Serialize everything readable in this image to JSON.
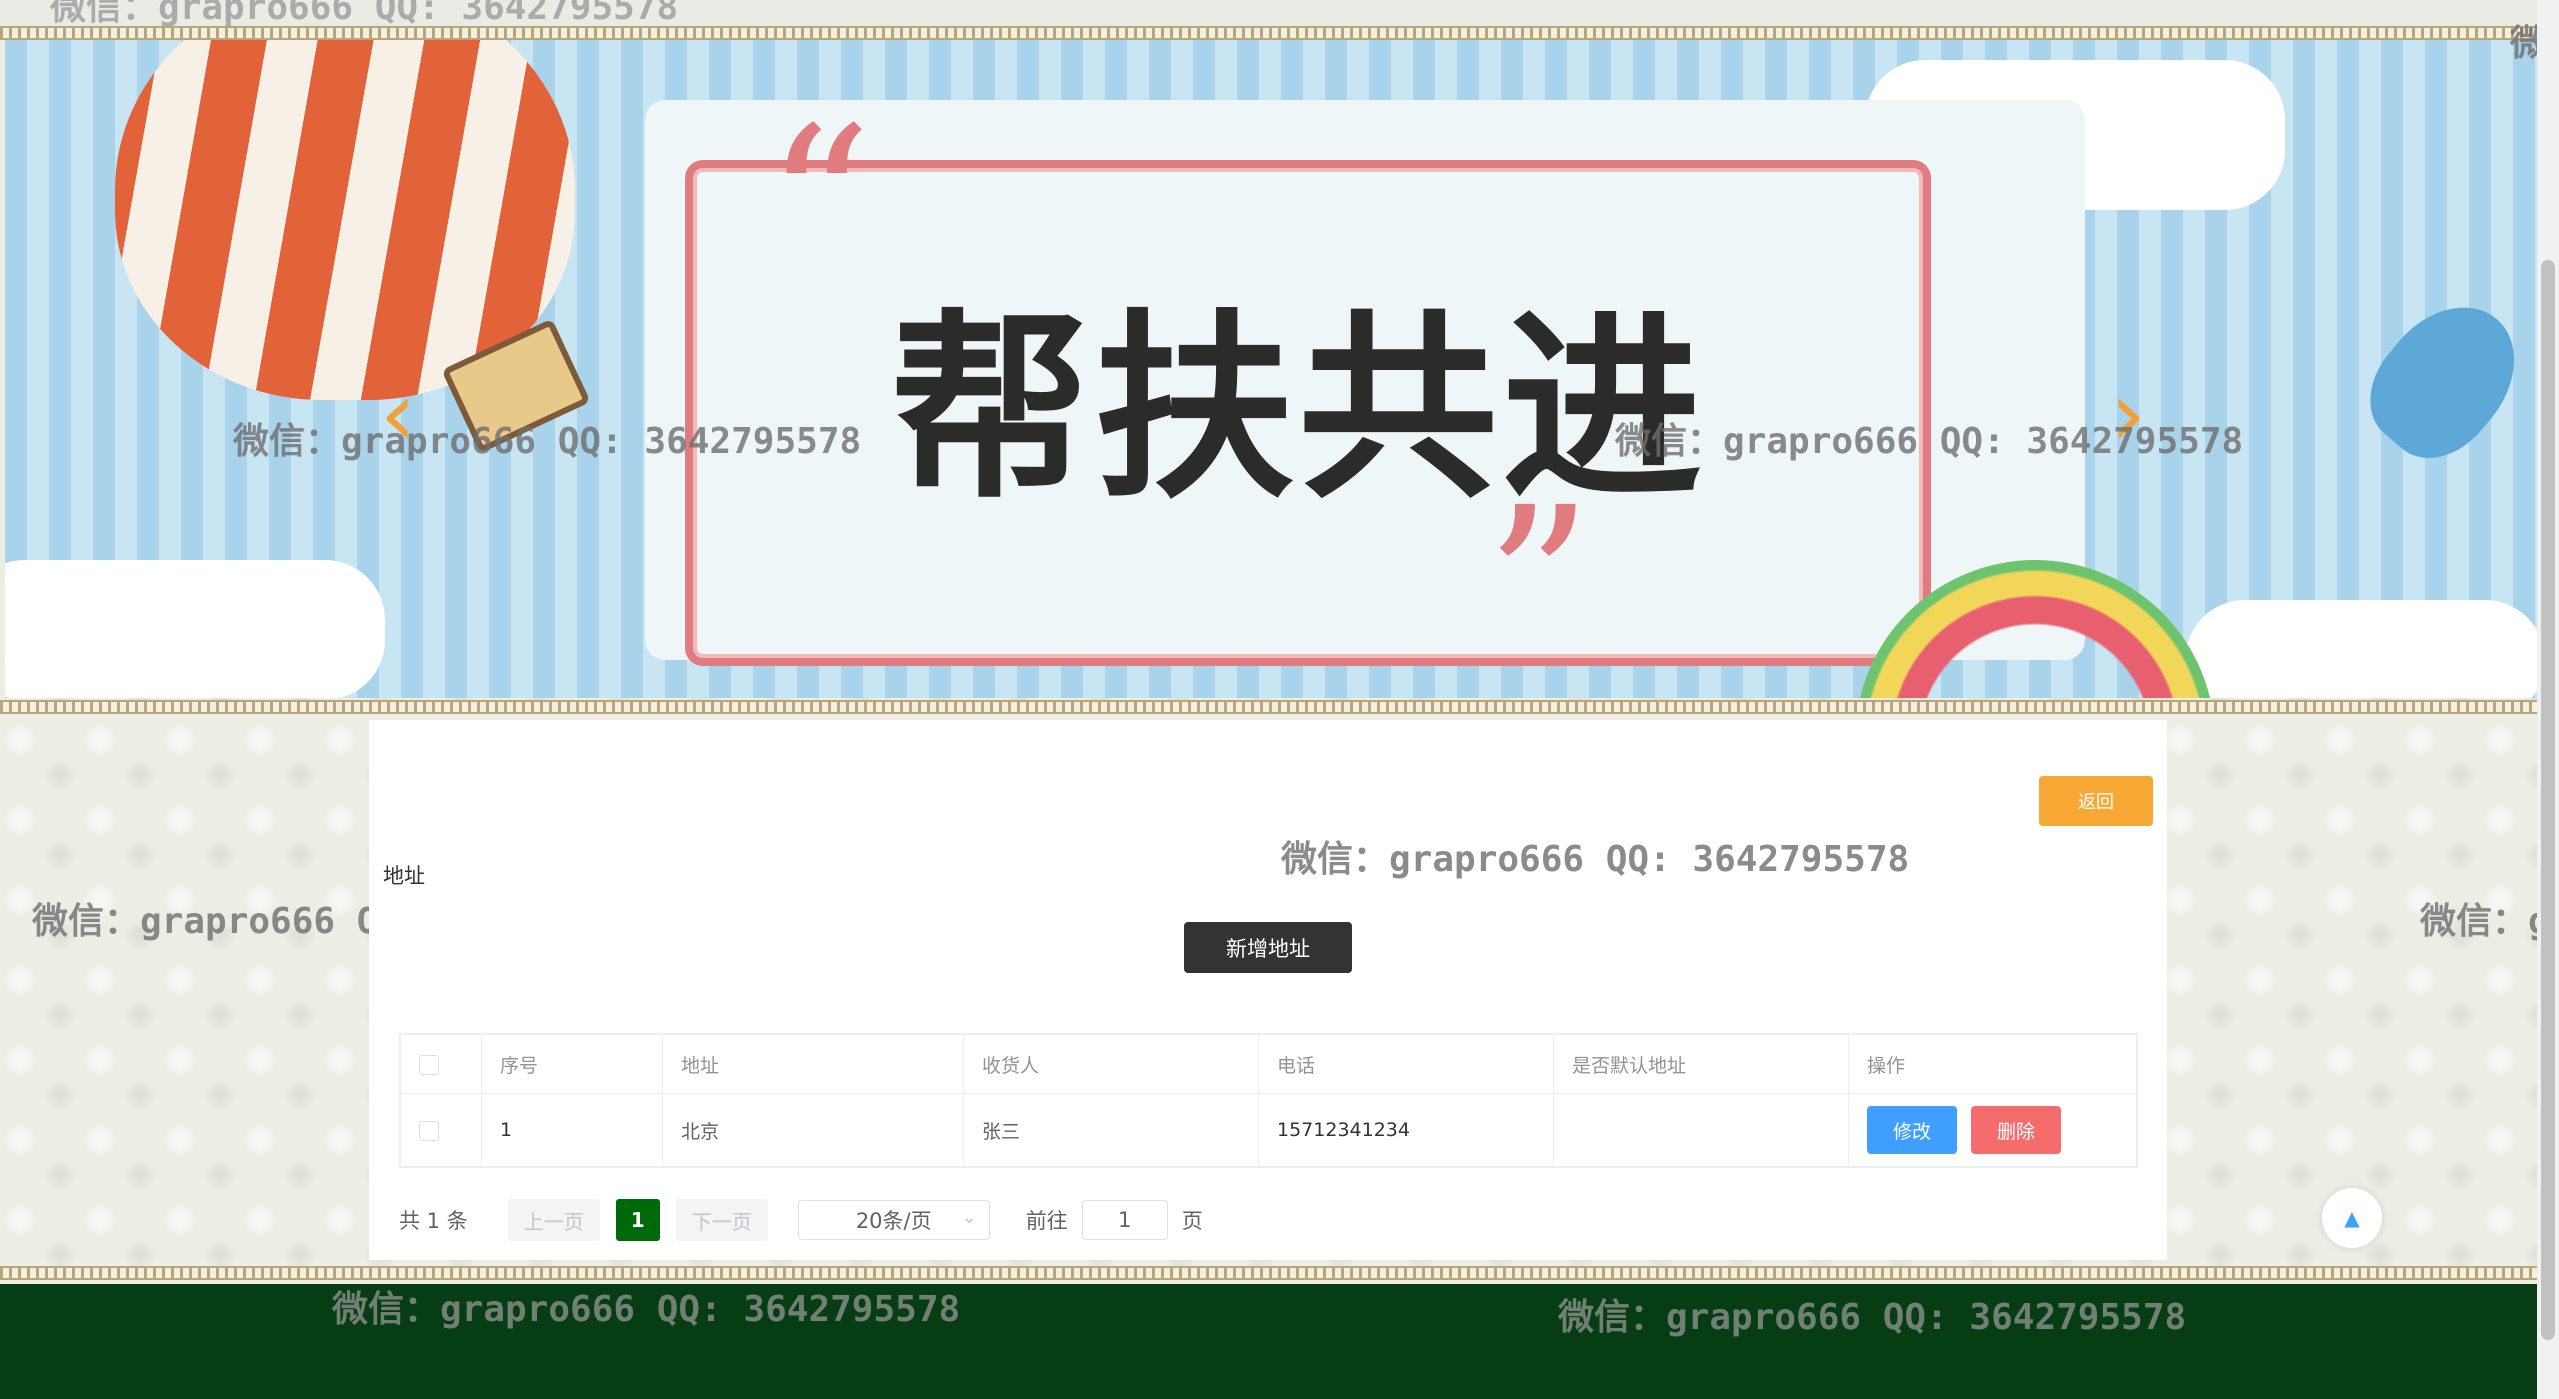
{
  "banner": {
    "title": "帮扶共进",
    "prev_arrow": "‹",
    "next_arrow": "›"
  },
  "watermark": "微信：grapro666 QQ: 3642795578",
  "watermark_partial_right": "微信：g",
  "watermark_edge": "微",
  "content": {
    "back_label": "返回",
    "section_title": "地址",
    "add_label": "新增地址"
  },
  "table": {
    "headers": [
      "序号",
      "地址",
      "收货人",
      "电话",
      "是否默认地址",
      "操作"
    ],
    "rows": [
      {
        "index": "1",
        "address": "北京",
        "receiver": "张三",
        "phone": "15712341234",
        "is_default": "",
        "edit_label": "修改",
        "delete_label": "删除"
      }
    ]
  },
  "pagination": {
    "total_text": "共 1 条",
    "prev_label": "上一页",
    "current_page": "1",
    "next_label": "下一页",
    "page_size": "20条/页",
    "goto_prefix": "前往",
    "goto_value": "1",
    "goto_suffix": "页"
  },
  "colors": {
    "back_button": "#f8a935",
    "add_button": "#333333",
    "edit_button": "#409eff",
    "delete_button": "#f56c6c",
    "active_page": "#006a0b",
    "footer": "#063d13"
  },
  "icons": {
    "back_to_top": "chevron-up-icon",
    "select_caret": "chevron-down-icon"
  }
}
